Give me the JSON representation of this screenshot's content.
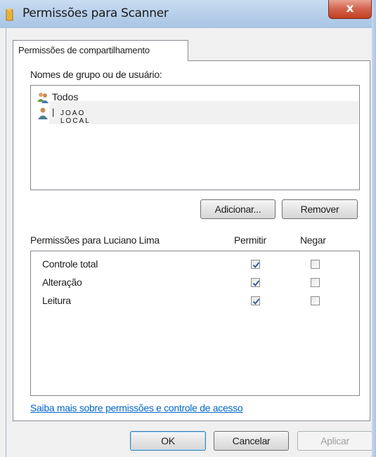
{
  "window": {
    "title": "Permissões para Scanner",
    "close_label": "x"
  },
  "tab": {
    "label": "Permissões de compartilhamento"
  },
  "groups": {
    "heading": "Nomes de grupo ou de usuário:",
    "items": [
      {
        "label": "Todos",
        "icon": "group-users-icon"
      },
      {
        "label": "JOAO LOCAL",
        "icon": "user-icon"
      }
    ]
  },
  "group_buttons": {
    "add": "Adicionar...",
    "remove": "Remover"
  },
  "permissions": {
    "heading": "Permissões para Luciano Lima",
    "allow_header": "Permitir",
    "deny_header": "Negar",
    "rows": [
      {
        "label": "Controle total",
        "allow": true,
        "deny": false
      },
      {
        "label": "Alteração",
        "allow": true,
        "deny": false
      },
      {
        "label": "Leitura",
        "allow": true,
        "deny": false
      }
    ]
  },
  "help_link": "Saiba mais sobre permissões e controle de acesso",
  "footer": {
    "ok": "OK",
    "cancel": "Cancelar",
    "apply": "Aplicar"
  },
  "colors": {
    "link": "#0066cc",
    "check": "#3c5a9a"
  }
}
